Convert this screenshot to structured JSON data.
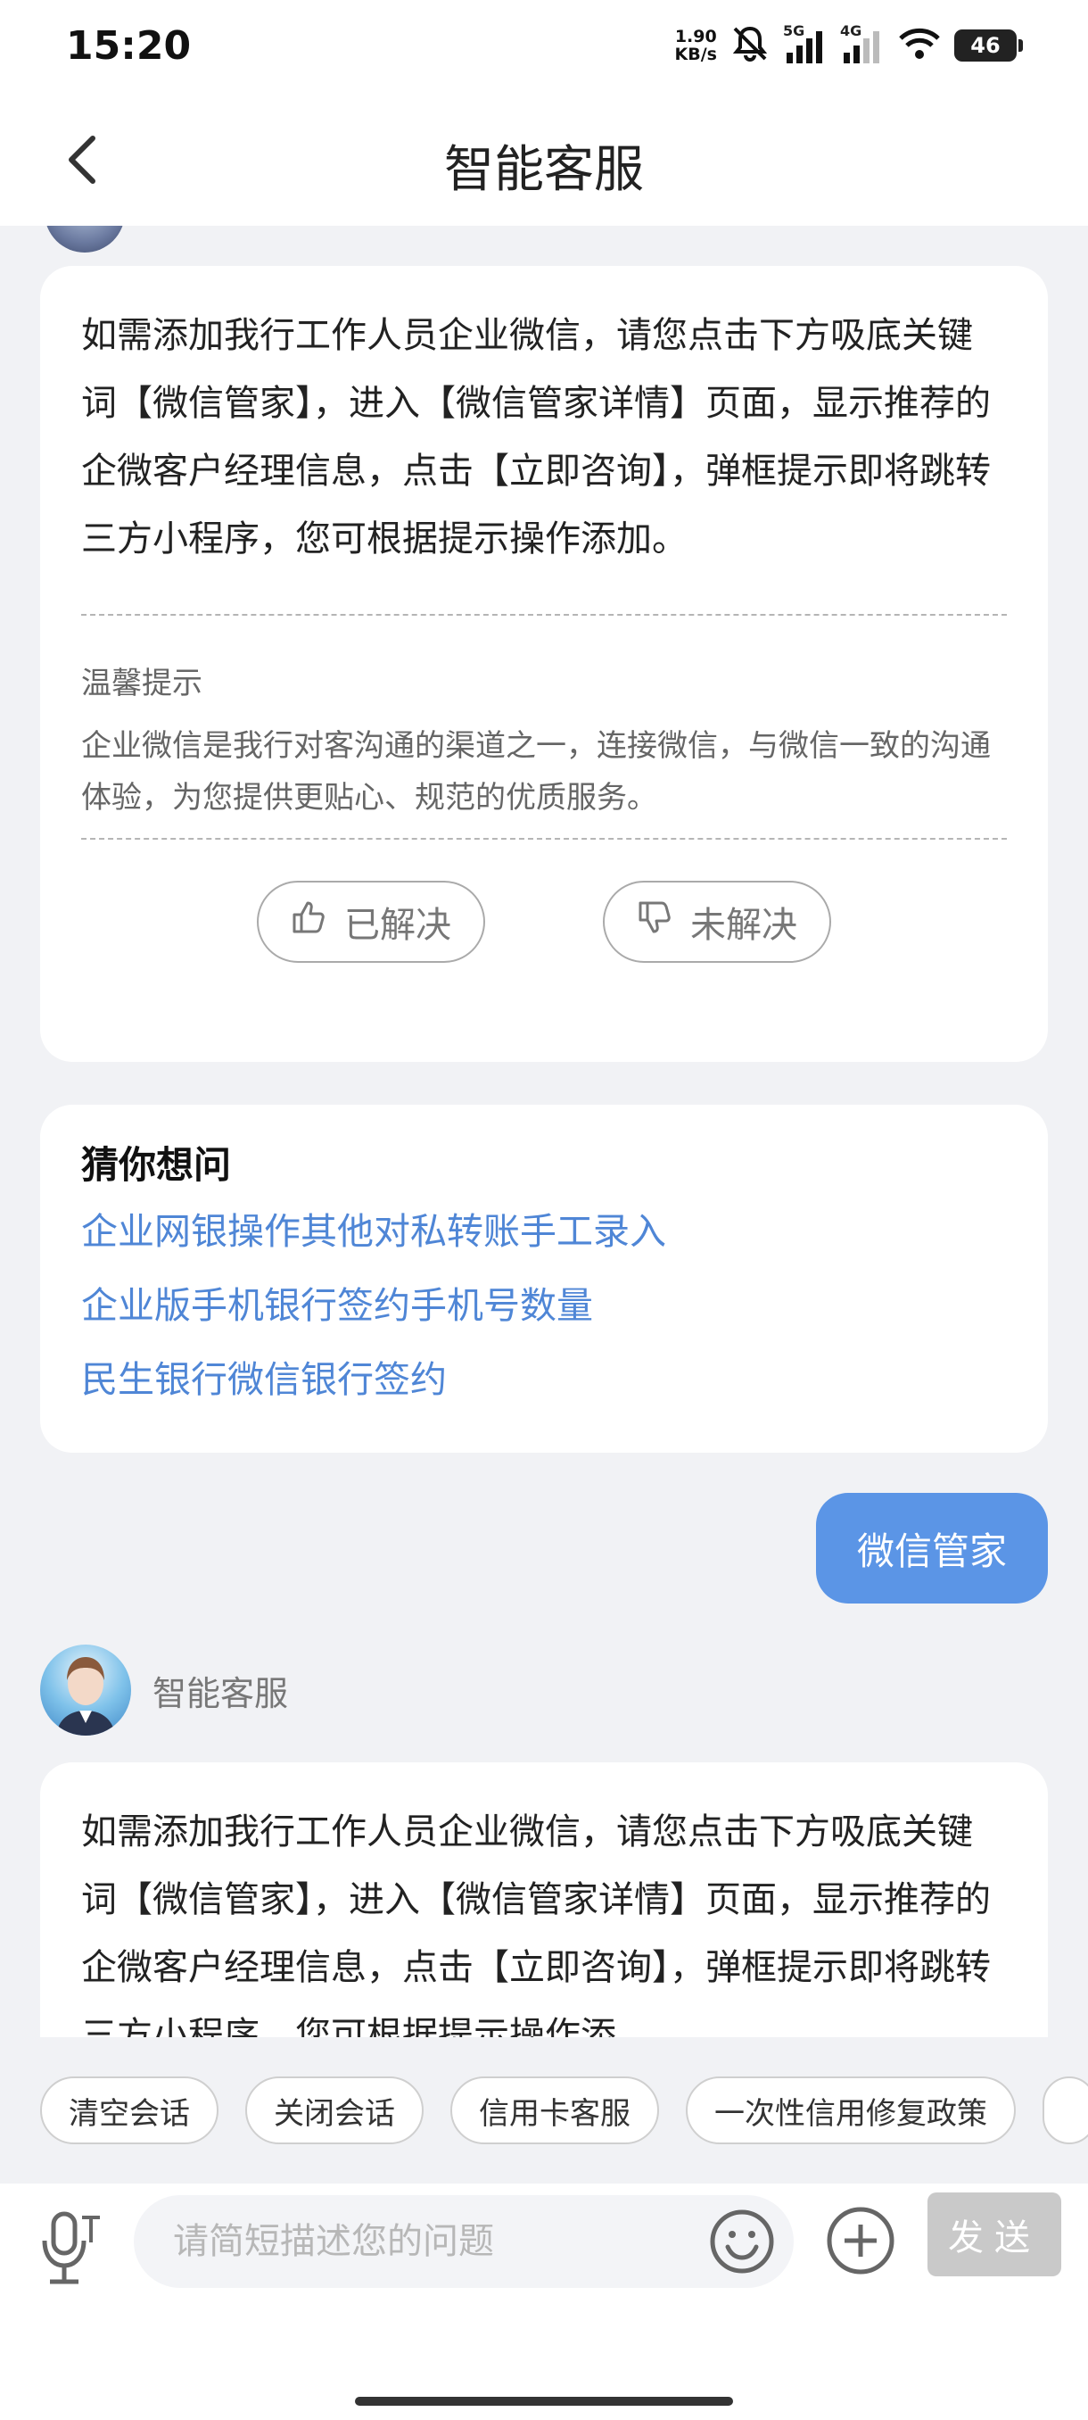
{
  "status_bar": {
    "time": "15:20",
    "net_speed_value": "1.90",
    "net_speed_unit": "KB/s",
    "signal1_label": "5G",
    "signal2_label": "4G",
    "battery": "46"
  },
  "header": {
    "title": "智能客服",
    "back_icon": "chevron-left-icon"
  },
  "messages": {
    "answer1": {
      "text": "如需添加我行工作人员企业微信，请您点击下方吸底关键词【微信管家】，进入【微信管家详情】页面，显示推荐的企微客户经理信息，点击【立即咨询】，弹框提示即将跳转三方小程序，您可根据提示操作添加。",
      "tip_title": "温馨提示",
      "tip_text": "企业微信是我行对客沟通的渠道之一，连接微信，与微信一致的沟通体验，为您提供更贴心、规范的优质服务。",
      "resolved_label": "已解决",
      "unresolved_label": "未解决"
    },
    "guess": {
      "title": "猜你想问",
      "items": [
        "企业网银操作其他对私转账手工录入",
        "企业版手机银行签约手机号数量",
        "民生银行微信银行签约"
      ]
    },
    "user_message": "微信管家",
    "agent_name": "智能客服",
    "answer2_text": "如需添加我行工作人员企业微信，请您点击下方吸底关键词【微信管家】，进入【微信管家详情】页面，显示推荐的企微客户经理信息，点击【立即咨询】，弹框提示即将跳转三方小程序，您可根据提示操作添"
  },
  "quick_buttons": [
    "清空会话",
    "关闭会话",
    "信用卡客服",
    "一次性信用修复政策"
  ],
  "input": {
    "placeholder": "请简短描述您的问题",
    "send_label": "发送"
  },
  "colors": {
    "accent": "#5b95e6",
    "link": "#4f86d6",
    "background": "#f1f2f5",
    "send_disabled": "#c9c9c9"
  }
}
